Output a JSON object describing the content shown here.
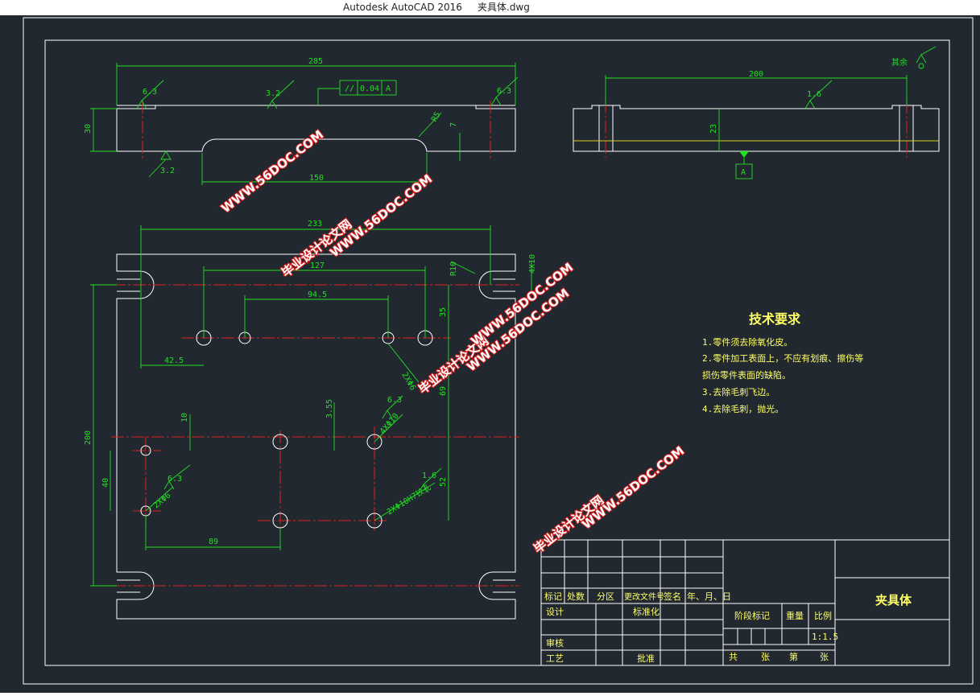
{
  "window": {
    "app": "Autodesk AutoCAD 2016",
    "file": "夹具体.dwg",
    "separator": "     "
  },
  "dimensions": {
    "top_length": "285",
    "top_height": "30",
    "slot": "150",
    "fillet_r": "R5",
    "depth": "7",
    "rough_left": "6.3",
    "rough_bottom": "3.2",
    "rough_mid": "3.2",
    "rough_right": "6.3",
    "tol_symbol": "//",
    "tol_value": "0.04",
    "tol_datum": "A",
    "side_length": "200",
    "side_height": "23",
    "side_rough": "1.6",
    "datum": "A",
    "rest_rough": "其余",
    "plan_width": "233",
    "plan_height": "200",
    "d_127": "127",
    "d_945": "94.5",
    "d_425": "42.5",
    "d_35": "35",
    "d_69": "69",
    "d_r10": "R10",
    "d_d10": "4X10",
    "d_355": "3.55",
    "d_10": "10",
    "d_40": "40",
    "d_89": "89",
    "d_52": "52",
    "d_holes1": "2XΦ6",
    "d_holes2": "4XΦ10",
    "d_holes3": "2XΦ6",
    "d_holes4": "2XΦ10H7铰孔",
    "r_63a": "6.3",
    "r_63b": "6.3",
    "r_16": "1.6"
  },
  "tech": {
    "title": "技术要求",
    "items": [
      "1.零件须去除氧化皮。",
      "2.零件加工表面上，不应有划痕、擦伤等",
      "损伤零件表面的缺陷。",
      "3.去除毛刺飞边。",
      "4.去除毛刺，抛光。"
    ]
  },
  "titleblock": {
    "h1": "标记",
    "h2": "处数",
    "h3": "分区",
    "h4": "更改文件号",
    "h5": "签名",
    "h6": "年、月、日",
    "design": "设计",
    "standard": "标准化",
    "review": "审核",
    "process": "工艺",
    "approve": "批准",
    "stage": "阶段标记",
    "weight": "重量",
    "scale_label": "比例",
    "scale": "1:1.5",
    "sheets": "共",
    "sheet_of": "张",
    "sheet_no": "第",
    "sheet_unit": "张",
    "name": "夹具体"
  },
  "watermark": {
    "site_cn": "毕业设计论文网",
    "url": "WWW.56DOC.COM"
  }
}
